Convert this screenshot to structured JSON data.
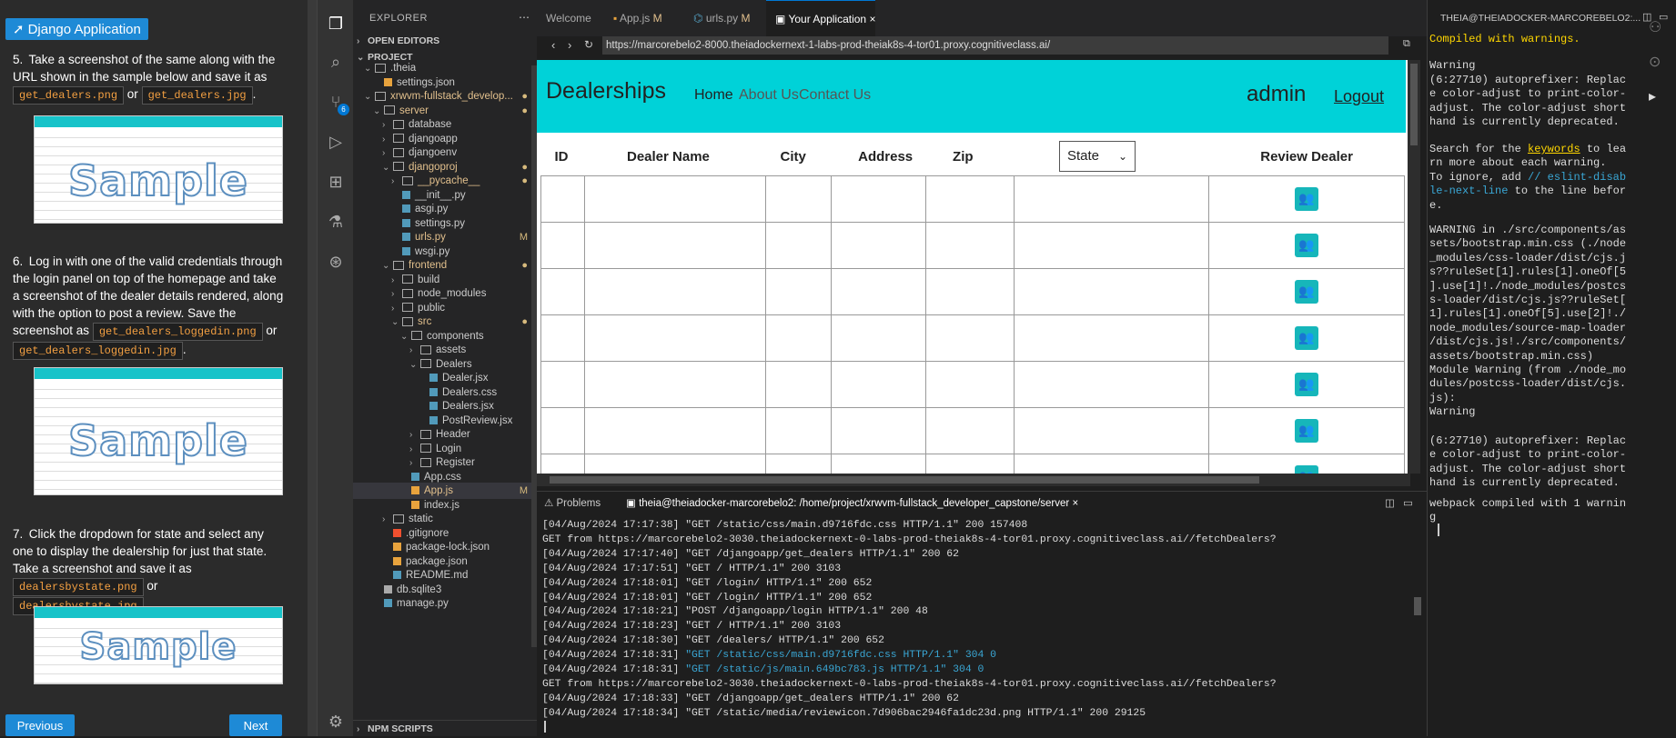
{
  "instructions": {
    "badge_label": "Django Application",
    "step5_text_a": "Take a screenshot of the same along with the URL shown in the sample below and save it as",
    "step5_code1": "get_dealers.png",
    "step5_or": "or",
    "step5_code2": "get_dealers.jpg",
    "step6_text_a": "Log in with one of the valid credentials through the login panel on top of the homepage and take a screenshot of the dealer details rendered, along with the option to post a review. Save the screenshot as",
    "step6_code1": "get_dealers_loggedin.png",
    "step6_or": "or",
    "step6_code2": "get_dealers_loggedin.jpg",
    "step7_text_a": "Click the dropdown for state and select any one to display the dealership for just that state. Take a screenshot and save it as",
    "step7_code1": "dealersbystate.png",
    "step7_or": "or",
    "step7_code2": "dealersbystate.jpg",
    "step5_num": "5.",
    "step6_num": "6.",
    "step7_num": "7.",
    "watermark": "Sample",
    "prev_label": "Previous",
    "next_label": "Next"
  },
  "explorer": {
    "title": "EXPLORER",
    "open_editors": "OPEN EDITORS",
    "project": "PROJECT",
    "npm_scripts": "NPM SCRIPTS",
    "items": [
      {
        "label": ".theia",
        "status": ""
      },
      {
        "label": "settings.json",
        "status": ""
      },
      {
        "label": "xrwvm-fullstack_develop...",
        "status": "●"
      },
      {
        "label": "server",
        "status": "●"
      },
      {
        "label": "database",
        "status": ""
      },
      {
        "label": "djangoapp",
        "status": ""
      },
      {
        "label": "djangoenv",
        "status": ""
      },
      {
        "label": "djangoproj",
        "status": "●"
      },
      {
        "label": "__pycache__",
        "status": "●"
      },
      {
        "label": "__init__.py",
        "status": ""
      },
      {
        "label": "asgi.py",
        "status": ""
      },
      {
        "label": "settings.py",
        "status": ""
      },
      {
        "label": "urls.py",
        "status": "M"
      },
      {
        "label": "wsgi.py",
        "status": ""
      },
      {
        "label": "frontend",
        "status": "●"
      },
      {
        "label": "build",
        "status": ""
      },
      {
        "label": "node_modules",
        "status": ""
      },
      {
        "label": "public",
        "status": ""
      },
      {
        "label": "src",
        "status": "●"
      },
      {
        "label": "components",
        "status": ""
      },
      {
        "label": "assets",
        "status": ""
      },
      {
        "label": "Dealers",
        "status": ""
      },
      {
        "label": "Dealer.jsx",
        "status": ""
      },
      {
        "label": "Dealers.css",
        "status": ""
      },
      {
        "label": "Dealers.jsx",
        "status": ""
      },
      {
        "label": "PostReview.jsx",
        "status": ""
      },
      {
        "label": "Header",
        "status": ""
      },
      {
        "label": "Login",
        "status": ""
      },
      {
        "label": "Register",
        "status": ""
      },
      {
        "label": "App.css",
        "status": ""
      },
      {
        "label": "App.js",
        "status": "M"
      },
      {
        "label": "index.js",
        "status": ""
      },
      {
        "label": "static",
        "status": ""
      },
      {
        "label": ".gitignore",
        "status": ""
      },
      {
        "label": "package-lock.json",
        "status": ""
      },
      {
        "label": "package.json",
        "status": ""
      },
      {
        "label": "README.md",
        "status": ""
      },
      {
        "label": "db.sqlite3",
        "status": ""
      },
      {
        "label": "manage.py",
        "status": ""
      }
    ]
  },
  "activity": {
    "scm_badge": "6"
  },
  "tabs": [
    {
      "label": "Welcome",
      "flag": ""
    },
    {
      "label": "App.js",
      "flag": "M"
    },
    {
      "label": "urls.py",
      "flag": "M"
    },
    {
      "label": "Your Application",
      "flag": "×"
    }
  ],
  "browser": {
    "url": "https://marcorebelo2-8000.theiadockernext-1-labs-prod-theiak8s-4-tor01.proxy.cognitiveclass.ai/"
  },
  "app": {
    "brand": "Dealerships",
    "nav_home": "Home",
    "nav_about": "About Us",
    "nav_contact": "Contact Us",
    "user": "admin",
    "logout": "Logout",
    "headers": [
      "ID",
      "Dealer Name",
      "City",
      "Address",
      "Zip",
      "Review Dealer"
    ],
    "state_select": "State",
    "row_count": 7
  },
  "terminal": {
    "problems_tab": "Problems",
    "tab_title": "theia@theiadocker-marcorebelo2: /home/project/xrwvm-fullstack_developer_capstone/server",
    "lines": [
      {
        "text": "[04/Aug/2024 17:17:38] \"GET /static/css/main.d9716fdc.css HTTP/1.1\" 200 157408",
        "color": "normal"
      },
      {
        "text": "GET from https://marcorebelo2-3030.theiadockernext-0-labs-prod-theiak8s-4-tor01.proxy.cognitiveclass.ai//fetchDealers?",
        "color": "normal"
      },
      {
        "text": "[04/Aug/2024 17:17:40] \"GET /djangoapp/get_dealers HTTP/1.1\" 200 62",
        "color": "normal"
      },
      {
        "text": "[04/Aug/2024 17:17:51] \"GET / HTTP/1.1\" 200 3103",
        "color": "normal"
      },
      {
        "text": "[04/Aug/2024 17:18:01] \"GET /login/ HTTP/1.1\" 200 652",
        "color": "normal"
      },
      {
        "text": "[04/Aug/2024 17:18:01] \"GET /login/ HTTP/1.1\" 200 652",
        "color": "normal"
      },
      {
        "text": "[04/Aug/2024 17:18:21] \"POST /djangoapp/login HTTP/1.1\" 200 48",
        "color": "normal"
      },
      {
        "text": "[04/Aug/2024 17:18:23] \"GET / HTTP/1.1\" 200 3103",
        "color": "normal"
      },
      {
        "text": "[04/Aug/2024 17:18:30] \"GET /dealers/ HTTP/1.1\" 200 652",
        "color": "normal"
      },
      {
        "text": "[04/Aug/2024 17:18:31] \"GET /static/css/main.d9716fdc.css HTTP/1.1\" 304 0",
        "color": "blue",
        "prefix": "[04/Aug/2024 17:18:31] "
      },
      {
        "text": "[04/Aug/2024 17:18:31] \"GET /static/js/main.649bc783.js HTTP/1.1\" 304 0",
        "color": "blue",
        "prefix": "[04/Aug/2024 17:18:31] "
      },
      {
        "text": "GET from https://marcorebelo2-3030.theiadockernext-0-labs-prod-theiak8s-4-tor01.proxy.cognitiveclass.ai//fetchDealers?",
        "color": "normal"
      },
      {
        "text": "[04/Aug/2024 17:18:33] \"GET /djangoapp/get_dealers HTTP/1.1\" 200 62",
        "color": "normal"
      },
      {
        "text": "[04/Aug/2024 17:18:34] \"GET /static/media/reviewicon.7d906bac2946fa1dc23d.png HTTP/1.1\" 200 29125",
        "color": "normal"
      }
    ]
  },
  "output": {
    "header": "THEIA@THEIADOCKER-MARCOREBELO2:...",
    "line_compiled": "Compiled with warnings.",
    "line_warning": "Warning",
    "block1": "(6:27710) autoprefixer: Replac\ne color-adjust to print-color-\nadjust. The color-adjust short\nhand is currently deprecated.",
    "search_a": "Search for the ",
    "search_kw": "keywords",
    "search_b": " to lea\nrn more about each warning.\nTo ignore, add ",
    "search_cm": "// eslint-disab\nle-next-line",
    "search_c": " to the line befor\ne.",
    "warn_kw": "WARNING",
    "warn_body": " in ./src/components/as\nsets/bootstrap.min.css (./node\n_modules/css-loader/dist/cjs.j\ns??ruleSet[1].rules[1].oneOf[5\n].use[1]!./node_modules/postcs\ns-loader/dist/cjs.js??ruleSet[\n1].rules[1].oneOf[5].use[2]!./\nnode_modules/source-map-loader\n/dist/cjs.js!./src/components/\nassets/bootstrap.min.css)\nModule Warning (from ./node_mo\ndules/postcss-loader/dist/cjs.\njs):\nWarning",
    "block2a": "(6:27710) autoprefixer: Replac\ne color-adjust to print-color-\nadjust. The color-adjust short\nhand is currently ",
    "block2_kw": "deprecated",
    "block2_end": ".",
    "final_a": "webpack compiled with ",
    "final_kw": "1 warnin\ng"
  }
}
